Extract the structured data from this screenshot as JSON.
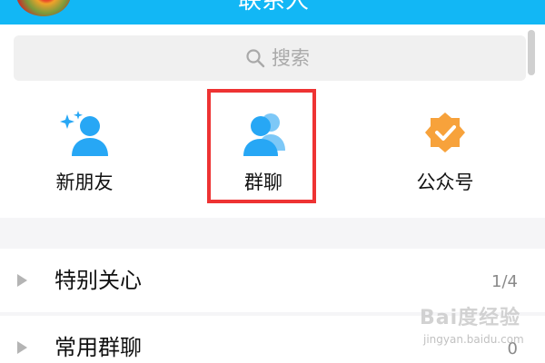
{
  "header": {
    "title": "联系人"
  },
  "search": {
    "placeholder": "搜索"
  },
  "shortcuts": [
    {
      "label": "新朋友",
      "icon": "new-friend-icon"
    },
    {
      "label": "群聊",
      "icon": "group-chat-icon"
    },
    {
      "label": "公众号",
      "icon": "official-account-icon"
    }
  ],
  "list": [
    {
      "label": "特别关心",
      "count": "1/4"
    },
    {
      "label": "常用群聊",
      "count": "0"
    }
  ],
  "watermark": {
    "text": "Bai度经验",
    "sub": "jingyan.baidu.com"
  },
  "colors": {
    "header": "#12b7f5",
    "icon_blue": "#27a7f5",
    "badge_orange": "#f7a23b",
    "highlight": "#ee3333"
  }
}
